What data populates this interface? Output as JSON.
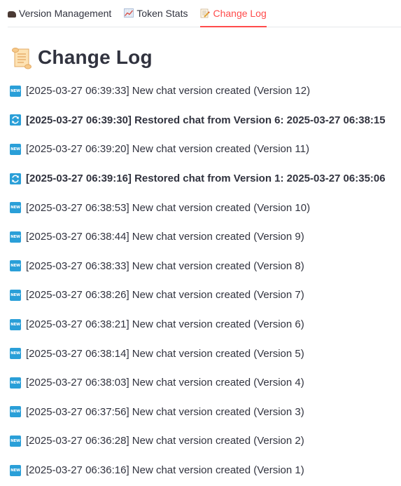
{
  "tabs": [
    {
      "label": "Version Management",
      "icon": "locomotive-icon",
      "active": false
    },
    {
      "label": "Token Stats",
      "icon": "chart-increasing-icon",
      "active": false
    },
    {
      "label": "Change Log",
      "icon": "memo-icon",
      "active": true
    }
  ],
  "page": {
    "title": "Change Log",
    "title_icon": "scroll-icon"
  },
  "badges": {
    "new_label": "NEW"
  },
  "colors": {
    "accent": "#ff4b4b",
    "badge": "#2a9fd8",
    "text": "#31333f"
  },
  "log": [
    {
      "type": "new",
      "text": "[2025-03-27 06:39:33] New chat version created (Version 12)"
    },
    {
      "type": "restore",
      "text": "[2025-03-27 06:39:30] Restored chat from Version 6: 2025-03-27 06:38:15"
    },
    {
      "type": "new",
      "text": "[2025-03-27 06:39:20] New chat version created (Version 11)"
    },
    {
      "type": "restore",
      "text": "[2025-03-27 06:39:16] Restored chat from Version 1: 2025-03-27 06:35:06"
    },
    {
      "type": "new",
      "text": "[2025-03-27 06:38:53] New chat version created (Version 10)"
    },
    {
      "type": "new",
      "text": "[2025-03-27 06:38:44] New chat version created (Version 9)"
    },
    {
      "type": "new",
      "text": "[2025-03-27 06:38:33] New chat version created (Version 8)"
    },
    {
      "type": "new",
      "text": "[2025-03-27 06:38:26] New chat version created (Version 7)"
    },
    {
      "type": "new",
      "text": "[2025-03-27 06:38:21] New chat version created (Version 6)"
    },
    {
      "type": "new",
      "text": "[2025-03-27 06:38:14] New chat version created (Version 5)"
    },
    {
      "type": "new",
      "text": "[2025-03-27 06:38:03] New chat version created (Version 4)"
    },
    {
      "type": "new",
      "text": "[2025-03-27 06:37:56] New chat version created (Version 3)"
    },
    {
      "type": "new",
      "text": "[2025-03-27 06:36:28] New chat version created (Version 2)"
    },
    {
      "type": "new",
      "text": "[2025-03-27 06:36:16] New chat version created (Version 1)"
    }
  ]
}
